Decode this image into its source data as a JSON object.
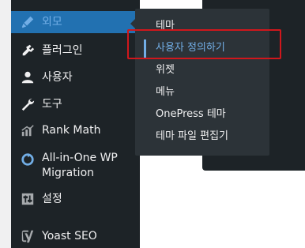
{
  "sidebar": {
    "items": [
      {
        "label": "외모",
        "icon": "appearance-brush-icon",
        "active": true
      },
      {
        "label": "플러그인",
        "icon": "plugin-icon"
      },
      {
        "label": "사용자",
        "icon": "user-icon"
      },
      {
        "label": "도구",
        "icon": "wrench-icon"
      },
      {
        "label": "Rank Math",
        "icon": "rank-math-icon"
      },
      {
        "label": "All-in-One WP Migration",
        "icon": "migration-icon"
      },
      {
        "label": "설정",
        "icon": "settings-sliders-icon"
      },
      {
        "label": "Yoast SEO",
        "icon": "yoast-icon"
      }
    ]
  },
  "flyout": {
    "items": [
      {
        "label": "테마"
      },
      {
        "label": "사용자 정의하기",
        "current": true
      },
      {
        "label": "위젯"
      },
      {
        "label": "메뉴"
      },
      {
        "label": "OnePress 테마"
      },
      {
        "label": "테마 파일 편집기"
      }
    ]
  },
  "colors": {
    "sidebar_bg": "#1d2327",
    "active_bg": "#2271b1",
    "flyout_bg": "#2c3338",
    "highlight_text": "#72aee6",
    "annotation_red": "#d0171c"
  }
}
